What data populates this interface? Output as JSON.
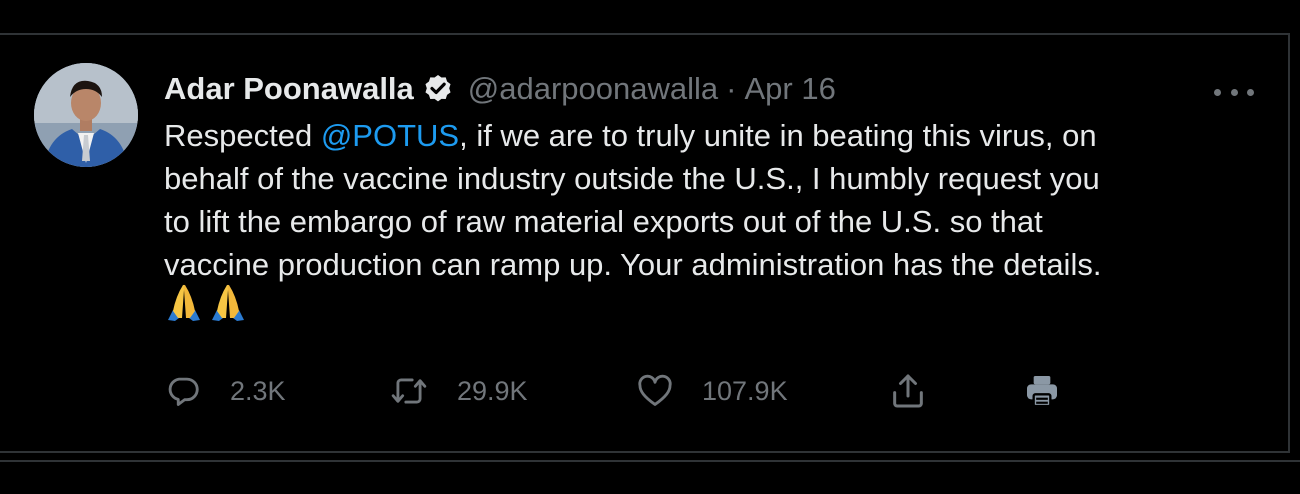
{
  "tweet": {
    "author_name": "Adar Poonawalla",
    "handle": "@adarpoonawalla",
    "separator": "·",
    "date": "Apr 16",
    "text_lines": [
      {
        "before": "Respected ",
        "mention": "@POTUS",
        "after": ", if we are to truly unite in beating this virus, on"
      },
      {
        "text": "behalf of the vaccine industry outside the U.S., I humbly request you"
      },
      {
        "text": "to lift the embargo of raw material exports out of the U.S. so that"
      },
      {
        "text": "vaccine production can ramp up. Your administration has the details."
      }
    ],
    "emojis": [
      "🙏",
      "🙏"
    ],
    "metrics": {
      "replies": "2.3K",
      "retweets": "29.9K",
      "likes": "107.9K"
    }
  },
  "icons": {
    "verified": "verified-badge-icon",
    "more": "more-options-icon",
    "reply": "reply-icon",
    "retweet": "retweet-icon",
    "like": "like-icon",
    "share": "share-icon",
    "print": "print-icon"
  },
  "colors": {
    "background": "#000000",
    "text": "#e7e9ea",
    "muted": "#71767b",
    "link": "#1d9bf0",
    "border": "#2f3336",
    "print_icon": "#8b98a5"
  }
}
